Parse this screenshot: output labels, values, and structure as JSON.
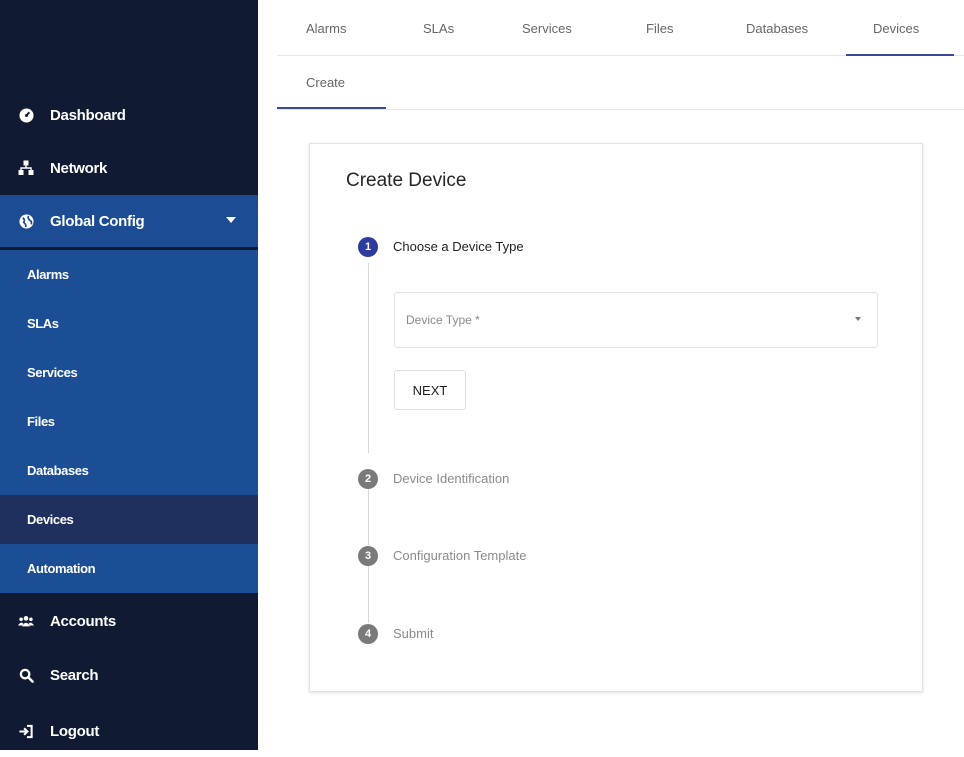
{
  "sidebar": {
    "items": [
      {
        "label": "Dashboard",
        "icon": "dashboard-icon"
      },
      {
        "label": "Network",
        "icon": "network-icon"
      },
      {
        "label": "Global Config",
        "icon": "globe-icon"
      },
      {
        "label": "Accounts",
        "icon": "accounts-icon"
      },
      {
        "label": "Search",
        "icon": "search-icon"
      },
      {
        "label": "Logout",
        "icon": "logout-icon"
      }
    ],
    "submenu": [
      "Alarms",
      "SLAs",
      "Services",
      "Files",
      "Databases",
      "Devices",
      "Automation"
    ],
    "selected_submenu": "Devices",
    "colors": {
      "background": "#101a33",
      "active": "#1c4c93",
      "selected": "#1f2f5e"
    }
  },
  "tabs": [
    "Alarms",
    "SLAs",
    "Services",
    "Files",
    "Databases",
    "Devices"
  ],
  "active_tab": "Devices",
  "subtab": "Create",
  "card": {
    "title": "Create Device",
    "steps": [
      {
        "number": "1",
        "label": "Choose a Device Type",
        "state": "active"
      },
      {
        "number": "2",
        "label": "Device Identification",
        "state": "inactive"
      },
      {
        "number": "3",
        "label": "Configuration Template",
        "state": "inactive"
      },
      {
        "number": "4",
        "label": "Submit",
        "state": "inactive"
      }
    ],
    "device_type_placeholder": "Device Type *",
    "next_label": "NEXT"
  },
  "accent_color": "#2b3c9e"
}
